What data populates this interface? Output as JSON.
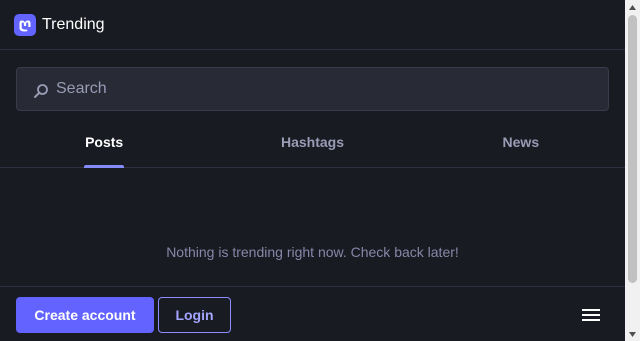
{
  "header": {
    "title": "Trending",
    "logo_icon": "mastodon-logo-icon"
  },
  "search": {
    "placeholder": "Search",
    "value": "",
    "icon": "search-icon"
  },
  "tabs": [
    {
      "label": "Posts",
      "active": true
    },
    {
      "label": "Hashtags",
      "active": false
    },
    {
      "label": "News",
      "active": false
    }
  ],
  "empty_state": {
    "message": "Nothing is trending right now. Check back later!"
  },
  "footer": {
    "create_account_label": "Create account",
    "login_label": "Login",
    "menu_icon": "hamburger-menu-icon"
  },
  "colors": {
    "background": "#191b22",
    "accent": "#6364ff",
    "tab_indicator": "#858afa",
    "muted_text": "#9a9bb5"
  }
}
